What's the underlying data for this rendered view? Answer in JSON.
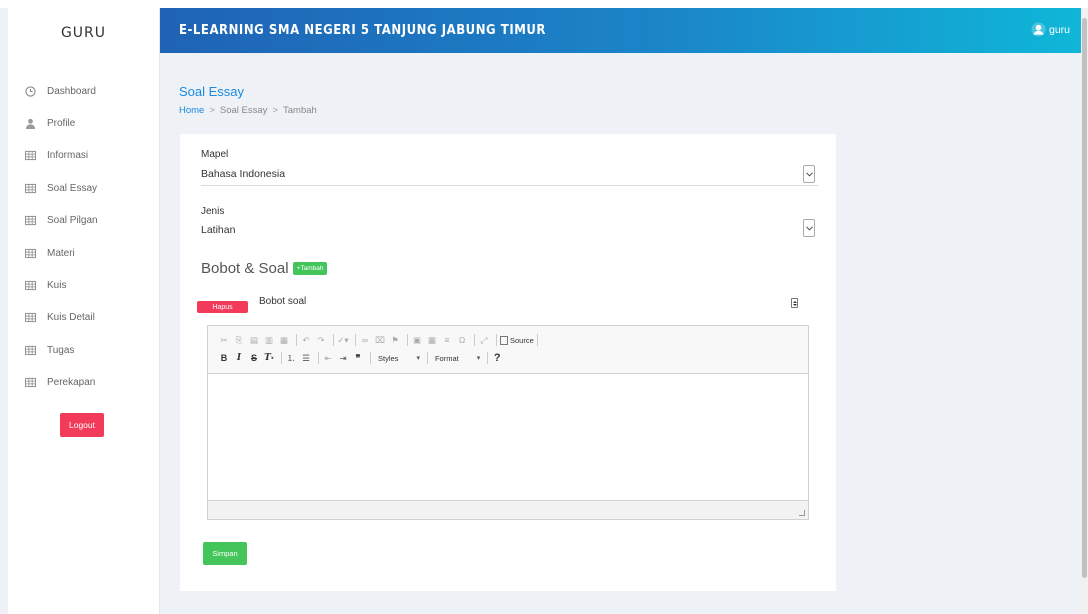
{
  "sidebar": {
    "brand": "GURU",
    "items": [
      {
        "label": "Dashboard",
        "icon": "clock-icon"
      },
      {
        "label": "Profile",
        "icon": "user-icon"
      },
      {
        "label": "Informasi",
        "icon": "table-icon"
      },
      {
        "label": "Soal Essay",
        "icon": "table-icon"
      },
      {
        "label": "Soal Pilgan",
        "icon": "table-icon"
      },
      {
        "label": "Materi",
        "icon": "table-icon"
      },
      {
        "label": "Kuis",
        "icon": "table-icon"
      },
      {
        "label": "Kuis Detail",
        "icon": "table-icon"
      },
      {
        "label": "Tugas",
        "icon": "table-icon"
      },
      {
        "label": "Perekapan",
        "icon": "table-icon"
      }
    ],
    "logout_label": "Logout"
  },
  "header": {
    "title": "E-LEARNING SMA NEGERI 5 TANJUNG JABUNG TIMUR",
    "user_name": "guru"
  },
  "page": {
    "title": "Soal Essay",
    "breadcrumb": [
      "Home",
      "Soal Essay",
      "Tambah"
    ]
  },
  "form": {
    "mapel_label": "Mapel",
    "mapel_value": "Bahasa Indonesia",
    "jenis_label": "Jenis",
    "jenis_value": "Latihan",
    "section_title": "Bobot & Soal",
    "tambah_label": "+Tambah",
    "hapus_label": "Hapus",
    "bobot_placeholder": "Bobot soal",
    "simpan_label": "Simpan"
  },
  "editor": {
    "styles_label": "Styles",
    "format_label": "Format",
    "source_label": "Source",
    "help_label": "?"
  },
  "colors": {
    "accent": "#1a8be0",
    "danger": "#f23b5a",
    "success": "#44c55a",
    "header_start": "#1f63b4",
    "header_end": "#0fb7d8"
  }
}
